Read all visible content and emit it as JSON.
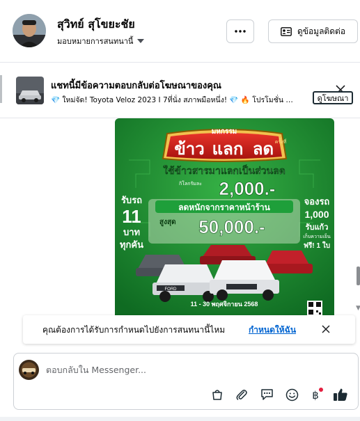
{
  "header": {
    "user_name": "สุวิทย์ สุโขยะชัย",
    "assign_label": "มอบหมายการสนทนานี้",
    "more_label": "···",
    "contact_label": "ดูข้อมูลติดต่อ"
  },
  "ad": {
    "title": "แชทนี้มีข้อความตอบกลับต่อโฆษณาของคุณ",
    "snippet": "💎 ใหม่จัด! Toyota Veloz 2023 I 7ที่นั่ง สภาพมือหนึ่ง! 💎 🔥 โปรโมชั่น …",
    "view_label": "ดูโฆษณา"
  },
  "promo": {
    "event_word": "มหกรรม",
    "headline_words": [
      "ข้าว",
      "แลก",
      "ลด"
    ],
    "times_label": "ครั้งที่",
    "subtitle": "ใช้ข้าวสารมาแลกเป็นส่วนลด",
    "per_kg_label": "กิโลกรัมละ",
    "per_kg_value": "2,000.-",
    "left_line1": "รับรถ",
    "left_number": "11",
    "left_line2": "บาท",
    "left_line3": "ทุกคัน",
    "right_line1": "จองรถ",
    "right_number": "1,000",
    "right_line2": "รับแก้ว",
    "right_line3": "เก็บความเย็น",
    "right_line4": "ฟรี! 1 ใบ",
    "discount_label": "ลดหนักจากราคาหน้าร้าน",
    "max_label": "สูงสุด",
    "max_value": "50,000.-",
    "date_text": "11 - 30 พฤศจิกายน 2568"
  },
  "banner": {
    "text": "คุณต้องการได้รับการกำหนดไปยังการสนทนานี้ไหม",
    "link": "กำหนดให้ฉัน"
  },
  "composer": {
    "placeholder": "ตอบกลับใน Messenger..."
  },
  "colors": {
    "promo_green": "#1f8f2e",
    "link_blue": "#0064d1",
    "like_blue": "#1c2b33",
    "badge_red": "#e41e3f"
  },
  "icons": [
    "more-icon",
    "contact-card-icon",
    "caret-down-icon",
    "close-icon",
    "bag-icon",
    "paperclip-icon",
    "chat-bubble-icon",
    "smiley-icon",
    "baht-icon",
    "thumbs-up-icon"
  ]
}
